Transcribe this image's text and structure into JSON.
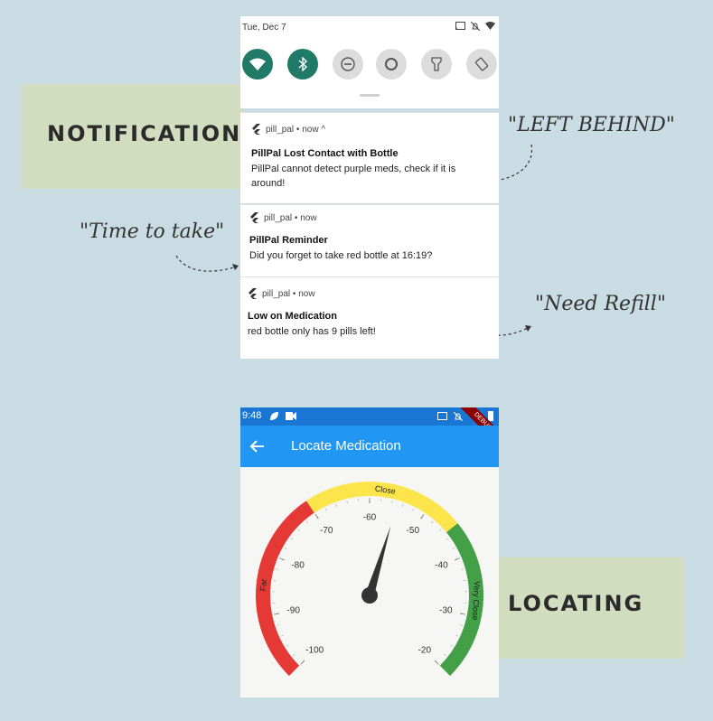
{
  "colors": {
    "background": "#c9dbe3",
    "label_block": "#d2ddc0",
    "qs_active": "#1f7a68",
    "appbar": "#2196f3",
    "statusbar": "#1976d2",
    "far": "#e53935",
    "close": "#fbe54a",
    "very_close": "#43a047"
  },
  "annotations": {
    "notifications_label": "NOTIFICATIONS",
    "locating_label": "LOCATING",
    "left_behind": "\"LEFT BEHIND\"",
    "time_to_take": "\"Time to take\"",
    "need_refill": "\"Need Refill\""
  },
  "shade": {
    "date": "Tue, Dec 7",
    "quick_settings": [
      {
        "icon": "wifi-icon",
        "active": true
      },
      {
        "icon": "bluetooth-icon",
        "active": true
      },
      {
        "icon": "do-not-disturb-icon",
        "active": false
      },
      {
        "icon": "alexa-ring-icon",
        "active": false
      },
      {
        "icon": "flashlight-icon",
        "active": false
      },
      {
        "icon": "auto-rotate-icon",
        "active": false
      }
    ]
  },
  "notifications": [
    {
      "app": "pill_pal • now ^",
      "title": "PillPal Lost Contact with Bottle",
      "body": "PillPal cannot detect purple meds, check if it is around!"
    },
    {
      "app": "pill_pal • now",
      "title": "PillPal Reminder",
      "body": "Did you forget to take red bottle at 16:19?"
    },
    {
      "app": "pill_pal • now",
      "title": "Low on Medication",
      "body": "red bottle only has 9 pills left!"
    }
  ],
  "locate_screen": {
    "time": "9:48",
    "debug_banner": "DEBUG",
    "back_icon": "back-arrow-icon",
    "title": "Locate Medication",
    "gauge": {
      "min": -100,
      "max": -20,
      "needle_value": -55,
      "ticks": [
        "-100",
        "-90",
        "-80",
        "-70",
        "-60",
        "-50",
        "-40",
        "-30",
        "-20"
      ],
      "ranges": [
        {
          "label": "Far",
          "from": -100,
          "to": -70,
          "color": "#e53935"
        },
        {
          "label": "Close",
          "from": -70,
          "to": -45,
          "color": "#fbe54a"
        },
        {
          "label": "Very Close",
          "from": -45,
          "to": -20,
          "color": "#43a047"
        }
      ]
    }
  }
}
